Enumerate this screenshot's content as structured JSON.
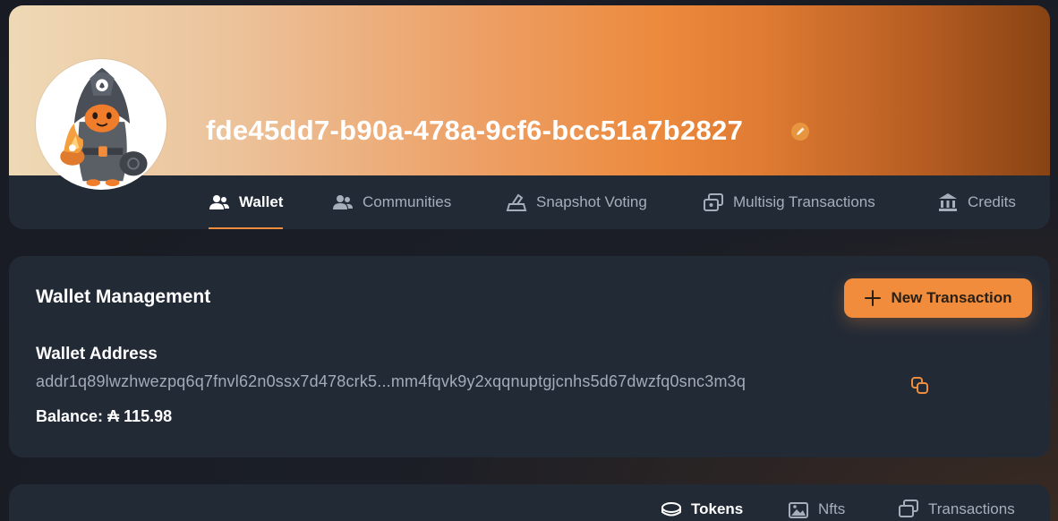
{
  "profile": {
    "title": "fde45dd7-b90a-478a-9cf6-bcc51a7b2827",
    "avatar_icon": "hooded-mascot-avatar",
    "edit_icon": "pencil-icon",
    "tabs": [
      {
        "label": "Wallet",
        "icon": "users-icon",
        "active": true
      },
      {
        "label": "Communities",
        "icon": "users-icon",
        "active": false
      },
      {
        "label": "Snapshot Voting",
        "icon": "ballot-box-icon",
        "active": false
      },
      {
        "label": "Multisig Transactions",
        "icon": "multisig-icon",
        "active": false
      },
      {
        "label": "Credits",
        "icon": "bank-icon",
        "active": false
      }
    ]
  },
  "wallet": {
    "heading": "Wallet Management",
    "new_transaction_label": "New Transaction",
    "address_label": "Wallet Address",
    "address_value": "addr1q89lwzhwezpq6q7fnvl62n0ssx7d478crk5...mm4fqvk9y2xqqnuptgjcnhs5d67dwzfq0snc3m3q",
    "balance_label": "Balance:",
    "balance_value": "₳ 115.98"
  },
  "asset_tabs": [
    {
      "label": "Tokens",
      "icon": "coins-icon",
      "active": true
    },
    {
      "label": "Nfts",
      "icon": "image-icon",
      "active": false
    },
    {
      "label": "Transactions",
      "icon": "transactions-icon",
      "active": false
    }
  ],
  "colors": {
    "accent": "#f08c3c",
    "card_bg": "#222a36",
    "page_bg": "#1b1e26"
  }
}
